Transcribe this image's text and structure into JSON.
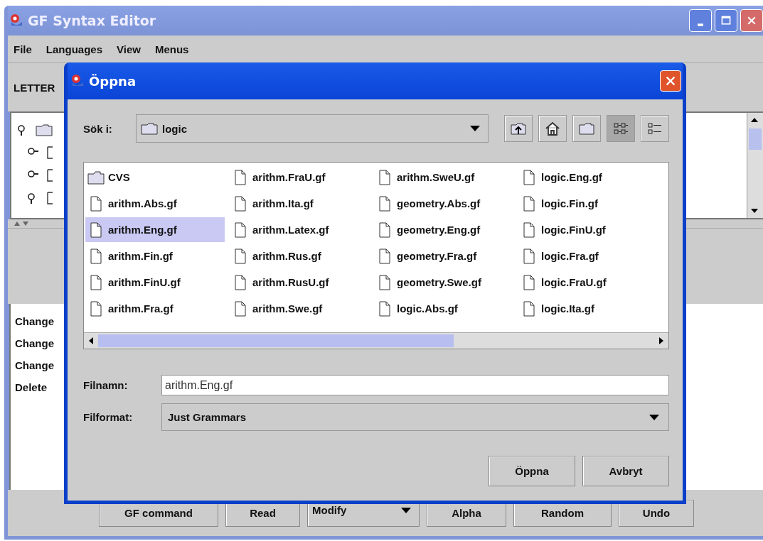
{
  "window": {
    "title": "GF Syntax Editor"
  },
  "menu": [
    "File",
    "Languages",
    "View",
    "Menus"
  ],
  "toolbar_label": "LETTER",
  "tree": [
    {
      "kind": "folder",
      "expanded": true
    },
    {
      "kind": "leaf",
      "expanded": false
    },
    {
      "kind": "leaf",
      "expanded": false
    },
    {
      "kind": "leaf",
      "expanded": true
    }
  ],
  "commands": [
    "Change",
    "Change",
    "Change",
    "Delete"
  ],
  "bottom_buttons": [
    {
      "kind": "button",
      "label": "GF command"
    },
    {
      "kind": "button",
      "label": "Read"
    },
    {
      "kind": "dropdown",
      "label": "Modify"
    },
    {
      "kind": "button",
      "label": "Alpha"
    },
    {
      "kind": "button",
      "label": "Random"
    },
    {
      "kind": "button",
      "label": "Undo"
    }
  ],
  "dialog": {
    "title": "Öppna",
    "look_in": {
      "label": "Sök i:",
      "value": "logic"
    },
    "view_modes": [
      {
        "kind": "list",
        "selected": true
      },
      {
        "kind": "details",
        "selected": false
      }
    ],
    "files": [
      {
        "kind": "folder",
        "name": "CVS",
        "selected": false
      },
      {
        "kind": "file",
        "name": "arithm.Abs.gf",
        "selected": false
      },
      {
        "kind": "file",
        "name": "arithm.Eng.gf",
        "selected": true
      },
      {
        "kind": "file",
        "name": "arithm.Fin.gf",
        "selected": false
      },
      {
        "kind": "file",
        "name": "arithm.FinU.gf",
        "selected": false
      },
      {
        "kind": "file",
        "name": "arithm.Fra.gf",
        "selected": false
      },
      {
        "kind": "file",
        "name": "arithm.FraU.gf",
        "selected": false
      },
      {
        "kind": "file",
        "name": "arithm.Ita.gf",
        "selected": false
      },
      {
        "kind": "file",
        "name": "arithm.Latex.gf",
        "selected": false
      },
      {
        "kind": "file",
        "name": "arithm.Rus.gf",
        "selected": false
      },
      {
        "kind": "file",
        "name": "arithm.RusU.gf",
        "selected": false
      },
      {
        "kind": "file",
        "name": "arithm.Swe.gf",
        "selected": false
      },
      {
        "kind": "file",
        "name": "arithm.SweU.gf",
        "selected": false
      },
      {
        "kind": "file",
        "name": "geometry.Abs.gf",
        "selected": false
      },
      {
        "kind": "file",
        "name": "geometry.Eng.gf",
        "selected": false
      },
      {
        "kind": "file",
        "name": "geometry.Fra.gf",
        "selected": false
      },
      {
        "kind": "file",
        "name": "geometry.Swe.gf",
        "selected": false
      },
      {
        "kind": "file",
        "name": "logic.Abs.gf",
        "selected": false
      },
      {
        "kind": "file",
        "name": "logic.Eng.gf",
        "selected": false
      },
      {
        "kind": "file",
        "name": "logic.Fin.gf",
        "selected": false
      },
      {
        "kind": "file",
        "name": "logic.FinU.gf",
        "selected": false
      },
      {
        "kind": "file",
        "name": "logic.Fra.gf",
        "selected": false
      },
      {
        "kind": "file",
        "name": "logic.FraU.gf",
        "selected": false
      },
      {
        "kind": "file",
        "name": "logic.Ita.gf",
        "selected": false
      }
    ],
    "file_name": {
      "label": "Filnamn:",
      "value": "arithm.Eng.gf"
    },
    "file_format": {
      "label": "Filformat:",
      "value": "Just Grammars"
    },
    "buttons": [
      "Öppna",
      "Avbryt"
    ]
  }
}
